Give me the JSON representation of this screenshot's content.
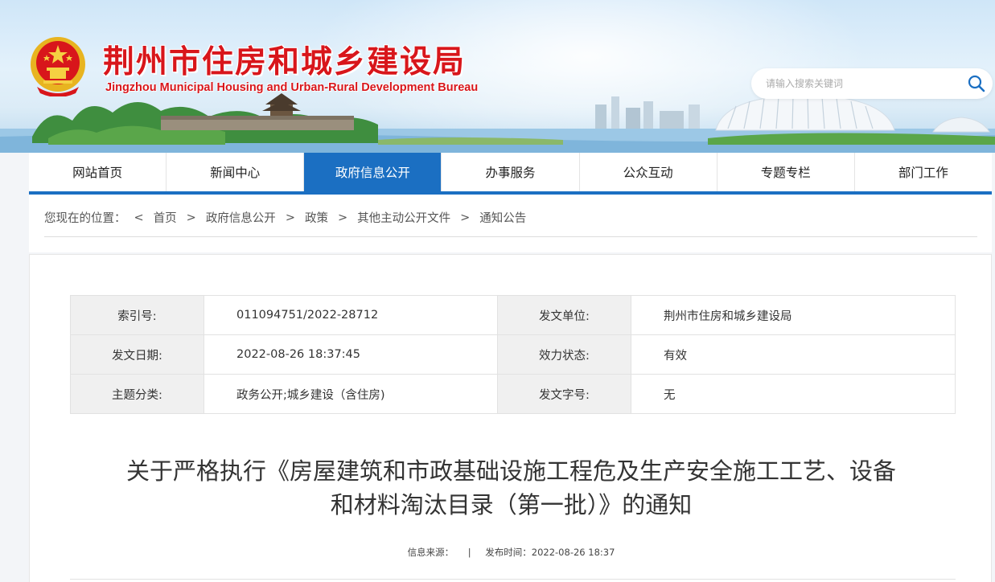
{
  "header": {
    "title": "荆州市住房和城乡建设局",
    "subtitle": "Jingzhou Municipal Housing and Urban-Rural Development Bureau",
    "emblem_icon": "national-emblem",
    "search": {
      "placeholder": "请输入搜索关键词",
      "icon": "search-icon"
    }
  },
  "nav": {
    "items": [
      {
        "label": "网站首页"
      },
      {
        "label": "新闻中心"
      },
      {
        "label": "政府信息公开",
        "active": true
      },
      {
        "label": "办事服务"
      },
      {
        "label": "公众互动"
      },
      {
        "label": "专题专栏"
      },
      {
        "label": "部门工作"
      }
    ],
    "active_color": "#1b6fc2"
  },
  "breadcrumb": {
    "prefix": "您现在的位置：",
    "lead_arrow": "<",
    "separator": ">",
    "items": [
      "首页",
      "政府信息公开",
      "政策",
      "其他主动公开文件",
      "通知公告"
    ]
  },
  "meta": {
    "rows": [
      {
        "k1": "索引号:",
        "v1": "011094751/2022-28712",
        "k2": "发文单位:",
        "v2": "荆州市住房和城乡建设局"
      },
      {
        "k1": "发文日期:",
        "v1": "2022-08-26 18:37:45",
        "k2": "效力状态:",
        "v2": "有效"
      },
      {
        "k1": "主题分类:",
        "v1": "政务公开;城乡建设（含住房)",
        "k2": "发文字号:",
        "v2": "无"
      }
    ]
  },
  "article": {
    "title_line1": "关于严格执行《房屋建筑和市政基础设施工程危及生产安全施工工艺、设备",
    "title_line2": "和材料淘汰目录（第一批）》的通知",
    "source_label": "信息来源：",
    "divider": "|",
    "publish_label": "发布时间：",
    "publish_time": "2022-08-26 18:37"
  },
  "colors": {
    "brand_red": "#d8161b",
    "nav_blue": "#1b6fc2"
  }
}
